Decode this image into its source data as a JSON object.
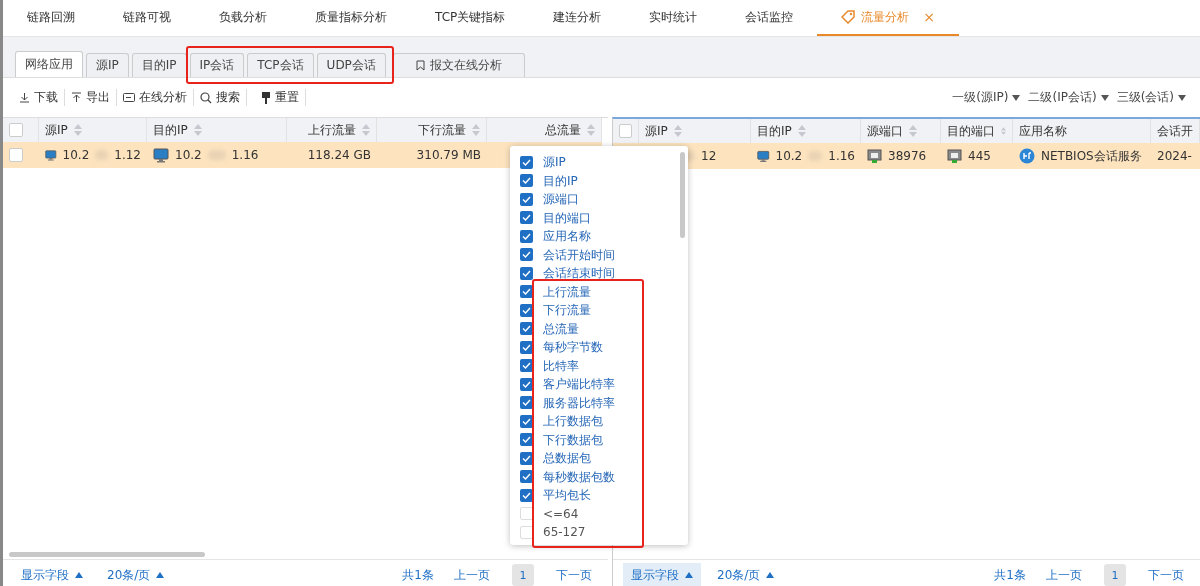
{
  "top_tabs": [
    {
      "label": "链路回溯",
      "selected": false
    },
    {
      "label": "链路可视",
      "selected": false
    },
    {
      "label": "负载分析",
      "selected": false
    },
    {
      "label": "质量指标分析",
      "selected": false
    },
    {
      "label": "TCP关键指标",
      "selected": false
    },
    {
      "label": "建连分析",
      "selected": false
    },
    {
      "label": "实时统计",
      "selected": false
    },
    {
      "label": "会话监控",
      "selected": false
    },
    {
      "label": "流量分析",
      "selected": true,
      "close": "×"
    }
  ],
  "sub_tabs": [
    {
      "label": "网络应用",
      "selected": true,
      "kind": "plain"
    },
    {
      "label": "源IP",
      "selected": false,
      "kind": "plain"
    },
    {
      "label": "目的IP",
      "selected": false,
      "kind": "plain"
    },
    {
      "label": "IP会话",
      "selected": false,
      "kind": "plain"
    },
    {
      "label": "TCP会话",
      "selected": false,
      "kind": "plain"
    },
    {
      "label": "UDP会话",
      "selected": false,
      "kind": "plain"
    },
    {
      "label": "报文在线分析",
      "selected": false,
      "kind": "bookmark"
    }
  ],
  "toolbar": [
    {
      "label": "下载"
    },
    {
      "label": "导出"
    },
    {
      "label": "在线分析"
    },
    {
      "label": "搜索"
    },
    {
      "label": "重置"
    }
  ],
  "level_selectors": [
    "一级(源IP)",
    "二级(IP会话)",
    "三级(会话)"
  ],
  "left_table": {
    "all_checked": false,
    "columns": [
      {
        "label": "源IP",
        "sortable": true
      },
      {
        "label": "目的IP",
        "sortable": true
      },
      {
        "label": "上行流量",
        "sortable": true
      },
      {
        "label": "下行流量",
        "sortable": true
      },
      {
        "label": "总流量",
        "sortable": true
      }
    ],
    "rows": [
      {
        "selected": true,
        "checked": false,
        "cells": [
          {
            "kind": "host",
            "prefix": "10.2",
            "suffix": "1.12"
          },
          {
            "kind": "host",
            "prefix": "10.2",
            "suffix": "1.16"
          },
          {
            "kind": "text",
            "value": "118.24 GB"
          },
          {
            "kind": "text",
            "value": "310.79 MB"
          }
        ]
      }
    ]
  },
  "right_table": {
    "all_checked": false,
    "columns": [
      {
        "label": "源IP",
        "sortable": true
      },
      {
        "label": "目的IP",
        "sortable": true
      },
      {
        "label": "源端口",
        "sortable": true
      },
      {
        "label": "目的端口",
        "sortable": true
      },
      {
        "label": "应用名称",
        "sortable": false
      },
      {
        "label": "会话开",
        "sortable": false
      }
    ],
    "rows": [
      {
        "selected": true,
        "cells": [
          {
            "kind": "masked",
            "suffix": "12"
          },
          {
            "kind": "host",
            "prefix": "10.2",
            "suffix": "1.16"
          },
          {
            "kind": "port",
            "value": "38976"
          },
          {
            "kind": "port",
            "value": "445"
          },
          {
            "kind": "app",
            "value": "NETBIOS会话服务"
          },
          {
            "kind": "text",
            "value": "2024-"
          }
        ]
      }
    ]
  },
  "column_picker": {
    "items": [
      {
        "label": "源IP",
        "checked": true
      },
      {
        "label": "目的IP",
        "checked": true
      },
      {
        "label": "源端口",
        "checked": true
      },
      {
        "label": "目的端口",
        "checked": true
      },
      {
        "label": "应用名称",
        "checked": true
      },
      {
        "label": "会话开始时间",
        "checked": true
      },
      {
        "label": "会话结束时间",
        "checked": true
      },
      {
        "label": "上行流量",
        "checked": true
      },
      {
        "label": "下行流量",
        "checked": true
      },
      {
        "label": "总流量",
        "checked": true
      },
      {
        "label": "每秒字节数",
        "checked": true
      },
      {
        "label": "比特率",
        "checked": true
      },
      {
        "label": "客户端比特率",
        "checked": true
      },
      {
        "label": "服务器比特率",
        "checked": true
      },
      {
        "label": "上行数据包",
        "checked": true
      },
      {
        "label": "下行数据包",
        "checked": true
      },
      {
        "label": "总数据包",
        "checked": true
      },
      {
        "label": "每秒数据包数",
        "checked": true
      },
      {
        "label": "平均包长",
        "checked": true
      },
      {
        "label": "<=64",
        "checked": false
      },
      {
        "label": "65-127",
        "checked": false
      }
    ]
  },
  "left_footer": {
    "fields_button": "显示字段",
    "fields_active": false,
    "page_size": "20条/页",
    "total": "共1条",
    "prev": "上一页",
    "page": "1",
    "next": "下一页"
  },
  "right_footer": {
    "fields_button": "显示字段",
    "fields_active": true,
    "page_size": "20条/页",
    "total": "共1条",
    "prev": "上一页",
    "page": "1",
    "next": "下一页"
  }
}
